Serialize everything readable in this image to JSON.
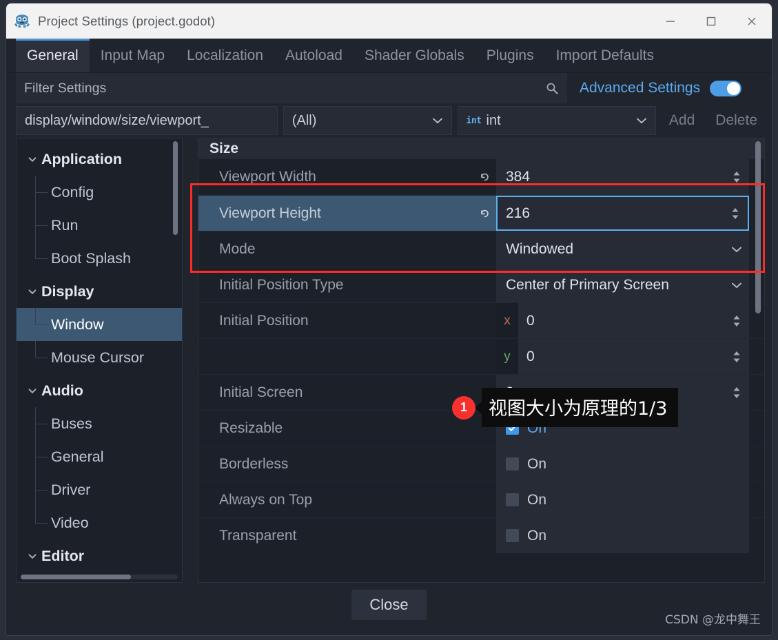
{
  "window": {
    "title": "Project Settings (project.godot)",
    "app_icon": "godot-robot-icon",
    "controls": {
      "minimize": "minimize-icon",
      "maximize": "maximize-icon",
      "close": "close-icon"
    }
  },
  "tabs": [
    {
      "label": "General",
      "active": true
    },
    {
      "label": "Input Map",
      "active": false
    },
    {
      "label": "Localization",
      "active": false
    },
    {
      "label": "Autoload",
      "active": false
    },
    {
      "label": "Shader Globals",
      "active": false
    },
    {
      "label": "Plugins",
      "active": false
    },
    {
      "label": "Import Defaults",
      "active": false
    }
  ],
  "filter": {
    "placeholder": "Filter Settings",
    "value": "",
    "icon": "search-icon",
    "advanced_label": "Advanced Settings",
    "advanced_enabled": true
  },
  "add_property": {
    "path_value": "display/window/size/viewport_",
    "feature_value": "(All)",
    "type_value": "int",
    "type_badge": "int",
    "add_label": "Add",
    "delete_label": "Delete"
  },
  "tree": [
    {
      "label": "Application",
      "kind": "category",
      "selected": false
    },
    {
      "label": "Config",
      "kind": "child",
      "selected": false
    },
    {
      "label": "Run",
      "kind": "child",
      "selected": false
    },
    {
      "label": "Boot Splash",
      "kind": "child",
      "selected": false
    },
    {
      "label": "Display",
      "kind": "category",
      "selected": false
    },
    {
      "label": "Window",
      "kind": "child",
      "selected": true
    },
    {
      "label": "Mouse Cursor",
      "kind": "child",
      "selected": false
    },
    {
      "label": "Audio",
      "kind": "category",
      "selected": false
    },
    {
      "label": "Buses",
      "kind": "child",
      "selected": false
    },
    {
      "label": "General",
      "kind": "child",
      "selected": false
    },
    {
      "label": "Driver",
      "kind": "child",
      "selected": false
    },
    {
      "label": "Video",
      "kind": "child",
      "selected": false
    },
    {
      "label": "Editor",
      "kind": "category",
      "selected": false
    }
  ],
  "properties": {
    "section_title": "Size",
    "rows": [
      {
        "label": "Viewport Width",
        "type": "spin",
        "value": "384",
        "revert": true,
        "highlight": false,
        "focused": false
      },
      {
        "label": "Viewport Height",
        "type": "spin",
        "value": "216",
        "revert": true,
        "highlight": true,
        "focused": true
      },
      {
        "label": "Mode",
        "type": "select",
        "value": "Windowed",
        "revert": false,
        "highlight": false,
        "focused": false
      },
      {
        "label": "Initial Position Type",
        "type": "select",
        "value": "Center of Primary Screen",
        "revert": false,
        "highlight": false,
        "focused": false
      },
      {
        "label": "Initial Position",
        "type": "vec",
        "value": "0",
        "axis": "x",
        "revert": false,
        "highlight": false,
        "focused": false
      },
      {
        "label": "",
        "type": "vec",
        "value": "0",
        "axis": "y",
        "revert": false,
        "highlight": false,
        "focused": false
      },
      {
        "label": "Initial Screen",
        "type": "spin",
        "value": "0",
        "revert": false,
        "highlight": false,
        "focused": false
      },
      {
        "label": "Resizable",
        "type": "check",
        "value": "On",
        "checked": true,
        "revert": false,
        "highlight": false,
        "focused": false
      },
      {
        "label": "Borderless",
        "type": "check",
        "value": "On",
        "checked": false,
        "revert": false,
        "highlight": false,
        "focused": false
      },
      {
        "label": "Always on Top",
        "type": "check",
        "value": "On",
        "checked": false,
        "revert": false,
        "highlight": false,
        "focused": false
      },
      {
        "label": "Transparent",
        "type": "check",
        "value": "On",
        "checked": false,
        "revert": false,
        "highlight": false,
        "focused": false
      }
    ]
  },
  "annotation": {
    "badge": "1",
    "text": "视图大小为原理的1/3",
    "box_color": "#ff2b26"
  },
  "footer": {
    "close_label": "Close",
    "watermark": "CSDN @龙中舞王"
  },
  "colors": {
    "accent": "#4d9ee6",
    "selection": "#3c5873",
    "panel": "#1c2029",
    "field": "#262b35",
    "annotation_red": "#ff2b26",
    "badge_red": "#f8312f"
  }
}
